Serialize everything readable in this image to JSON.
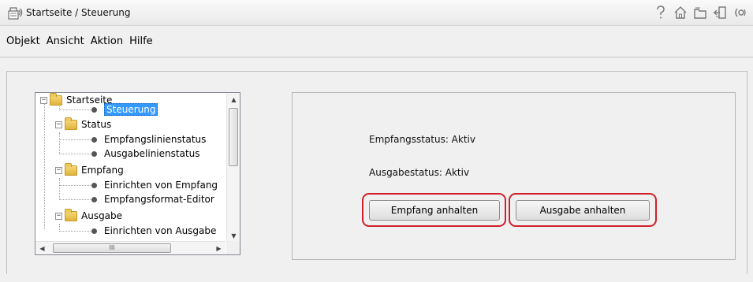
{
  "window": {
    "title": "Startseite / Steuerung",
    "icons": [
      "help-icon",
      "home-icon",
      "folder-icon",
      "exit-icon",
      "connection-icon"
    ]
  },
  "menu": {
    "items": [
      "Objekt",
      "Ansicht",
      "Aktion",
      "Hilfe"
    ]
  },
  "tree": {
    "items": [
      {
        "label": "Startseite",
        "type": "folder",
        "expanded": true
      },
      {
        "label": "Steuerung",
        "type": "node",
        "selected": true
      },
      {
        "label": "Status",
        "type": "folder",
        "expanded": true
      },
      {
        "label": "Empfangslinienstatus",
        "type": "node"
      },
      {
        "label": "Ausgabelinienstatus",
        "type": "node"
      },
      {
        "label": "Empfang",
        "type": "folder",
        "expanded": true
      },
      {
        "label": "Einrichten von Empfang",
        "type": "node"
      },
      {
        "label": "Empfangsformat-Editor",
        "type": "node"
      },
      {
        "label": "Ausgabe",
        "type": "folder",
        "expanded": true
      },
      {
        "label": "Einrichten von Ausgabe",
        "type": "node"
      }
    ],
    "hscroll_thumb_text": "III"
  },
  "status": {
    "empfang_status": "Empfangsstatus: Aktiv",
    "ausgabe_status": "Ausgabestatus: Aktiv"
  },
  "buttons": {
    "stop_receive": "Empfang anhalten",
    "stop_output": "Ausgabe anhalten"
  },
  "colors": {
    "highlight": "#d0202a",
    "selection": "#3399ff"
  }
}
